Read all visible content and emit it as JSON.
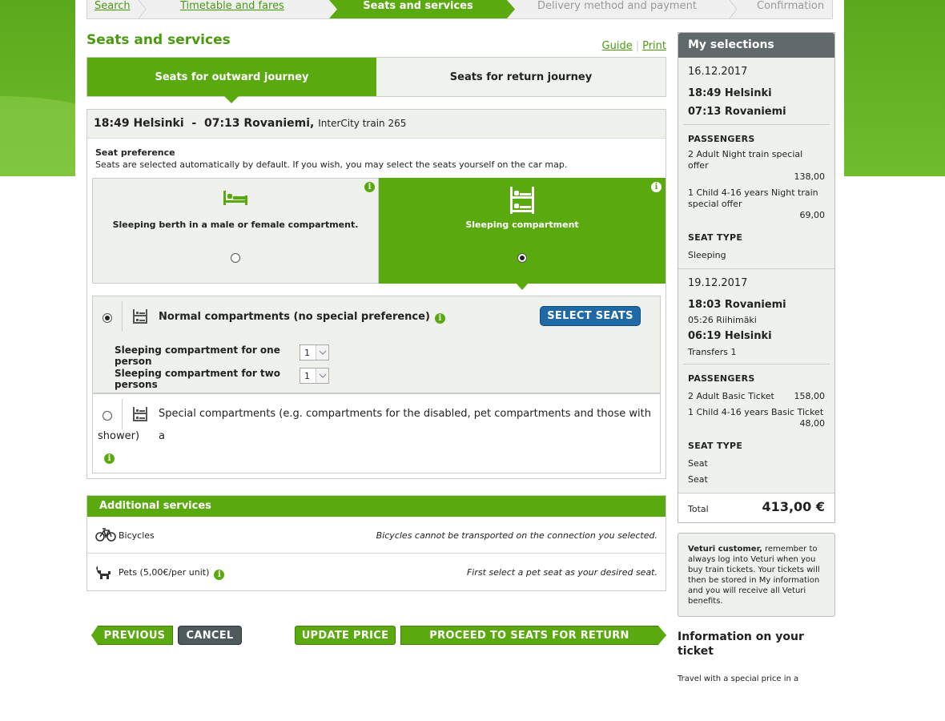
{
  "breadcrumb": [
    {
      "label": "Search",
      "state": "link"
    },
    {
      "label": "Timetable and fares",
      "state": "link"
    },
    {
      "label": "Seats and services",
      "state": "active"
    },
    {
      "label": "Delivery method and payment",
      "state": "future"
    },
    {
      "label": "Confirmation",
      "state": "future"
    }
  ],
  "page": {
    "title": "Seats and services",
    "guide": "Guide",
    "print": "Print"
  },
  "tabs": [
    {
      "label": "Seats for outward journey",
      "active": true
    },
    {
      "label": "Seats for return journey",
      "active": false
    }
  ],
  "journey": {
    "departure": "18:49 Helsinki",
    "dash": "-",
    "arrival": "07:13 Rovaniemi,",
    "train": "InterCity train 265"
  },
  "seat_preference": {
    "title": "Seat preference",
    "hint": "Seats are selected automatically by default. If you wish, you may select the seats yourself on the car map.",
    "options": [
      {
        "label": "Sleeping berth in a male or female compartment.",
        "icon": "bed-icon",
        "selected": false
      },
      {
        "label": "Sleeping compartment",
        "icon": "bunk-bed-icon",
        "selected": true
      }
    ]
  },
  "compartments": {
    "normal": {
      "label": "Normal compartments (no special preference)",
      "selected": true,
      "select_seats": "SELECT SEATS",
      "rows": [
        {
          "label": "Sleeping compartment for one person",
          "value": "1"
        },
        {
          "label": "Sleeping compartment for two persons",
          "value": "1"
        }
      ]
    },
    "special": {
      "label_line1": "Special compartments (e.g. compartments for the disabled, pet compartments and those with a",
      "label_line2": "shower)",
      "selected": false
    }
  },
  "additional": {
    "title": "Additional services",
    "rows": [
      {
        "label": "Bicycles",
        "note": "Bicycles cannot be transported on the connection you selected.",
        "icon": "bicycle-icon"
      },
      {
        "label": "Pets (5,00€/per unit)",
        "note": "First select a pet seat as your desired seat.",
        "icon": "dog-icon"
      }
    ]
  },
  "buttons": {
    "previous": "PREVIOUS",
    "cancel": "CANCEL",
    "update": "UPDATE PRICE",
    "proceed": "PROCEED TO SEATS FOR RETURN JOURNEY"
  },
  "selections": {
    "title": "My selections",
    "outward": {
      "date": "16.12.2017",
      "from": "18:49 Helsinki",
      "to": "07:13 Rovaniemi",
      "passengers_label": "PASSENGERS",
      "passengers": [
        {
          "name": "2 Adult Night train special offer",
          "price": "138,00"
        },
        {
          "name": "1 Child 4-16 years Night train special offer",
          "price": "69,00"
        }
      ],
      "seat_type_label": "SEAT TYPE",
      "seat_types": [
        "Sleeping"
      ]
    },
    "return": {
      "date": "19.12.2017",
      "from": "18:03 Rovaniemi",
      "via": "05:26 Riihimäki",
      "to": "06:19 Helsinki",
      "transfers": "Transfers 1",
      "passengers_label": "PASSENGERS",
      "passengers": [
        {
          "name": "2 Adult Basic Ticket",
          "price": "158,00"
        },
        {
          "name": "1 Child 4-16 years Basic Ticket",
          "price": "48,00"
        }
      ],
      "seat_type_label": "SEAT TYPE",
      "seat_types": [
        "Seat",
        "Seat"
      ]
    },
    "total_label": "Total",
    "total_value": "413,00 €"
  },
  "veturi": {
    "bold": "Veturi customer,",
    "text": " remember to always log into Veturi when you buy train tickets. Your tickets will then be stored in My information and you will receive all Veturi benefits."
  },
  "info": {
    "title": "Information on your ticket",
    "text": "Travel with a special price in a"
  },
  "colors": {
    "brand_green": "#5aa90f",
    "select_blue": "#1f6aa6",
    "sidebar_head": "#606a6c"
  }
}
